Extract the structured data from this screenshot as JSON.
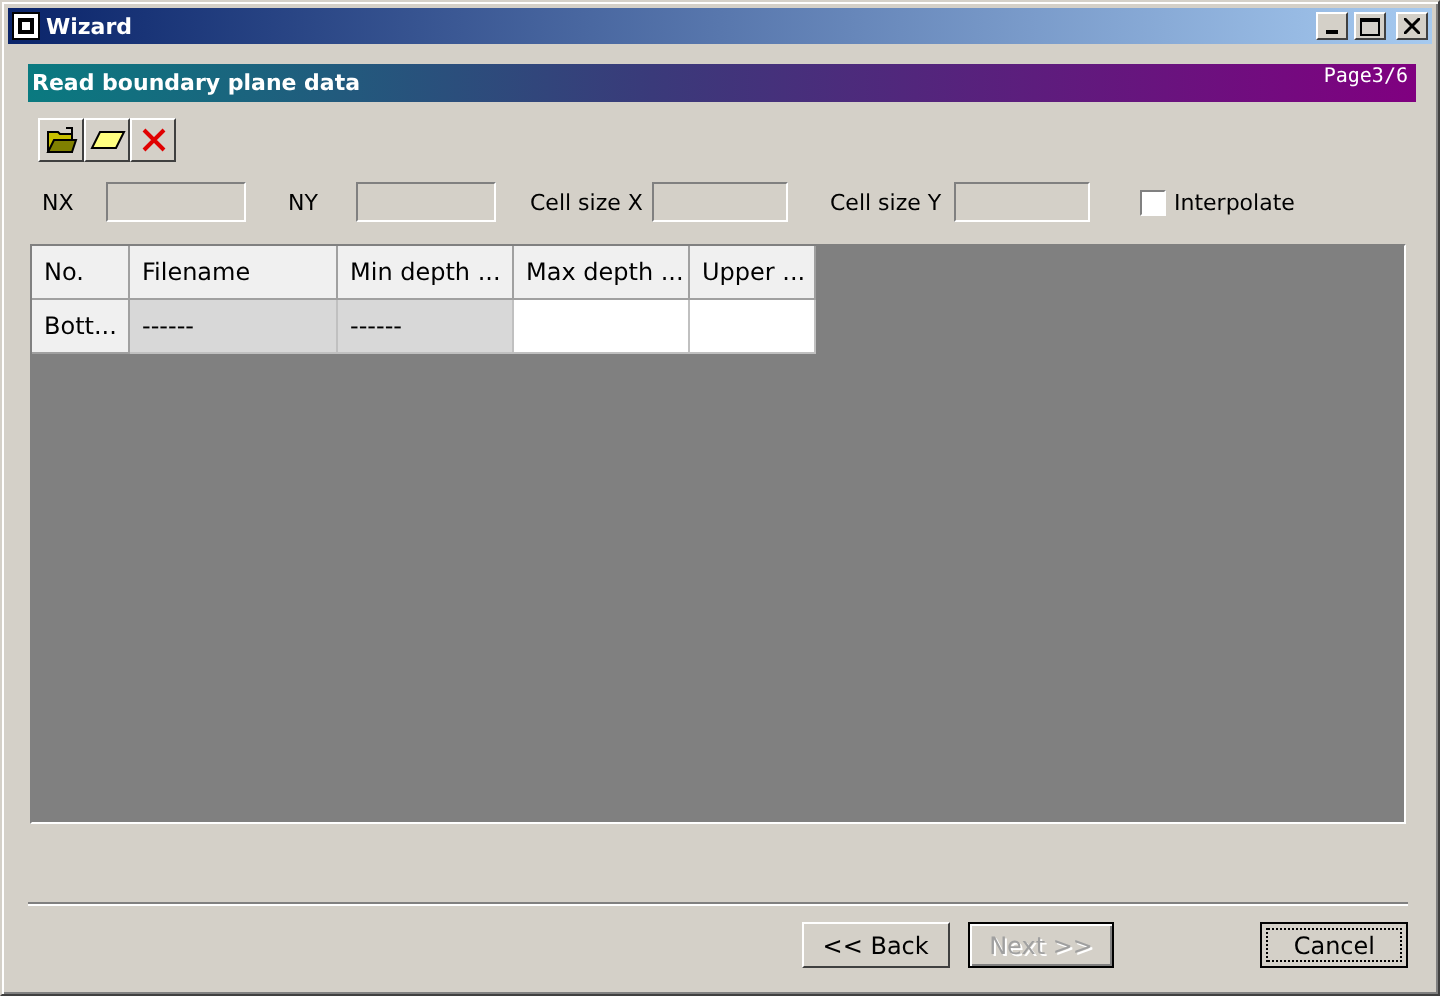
{
  "window": {
    "title": "Wizard"
  },
  "banner": {
    "title": "Read boundary plane data",
    "page": "Page3/6"
  },
  "toolbar": [
    {
      "kind": "open"
    },
    {
      "kind": "plane"
    },
    {
      "kind": "delete"
    }
  ],
  "fields": [
    {
      "label": "NX"
    },
    {
      "label": "NY"
    },
    {
      "label": "Cell size X"
    },
    {
      "label": "Cell size Y"
    }
  ],
  "interpolate": {
    "label": "Interpolate",
    "checked": false
  },
  "table": {
    "columns": [
      "No.",
      "Filename",
      "Min depth ...",
      "Max depth ...",
      "Upper ..."
    ],
    "rows": [
      {
        "cells": [
          {
            "text": "Bott...",
            "kind": "header"
          },
          {
            "text": "------",
            "kind": "readonly"
          },
          {
            "text": "------",
            "kind": "readonly"
          },
          {
            "text": "",
            "kind": "editable"
          },
          {
            "text": "",
            "kind": "editable"
          }
        ]
      }
    ]
  },
  "buttons": [
    {
      "label": "<< Back",
      "disabled": false,
      "focused": false
    },
    {
      "label": "Next >>",
      "disabled": true,
      "focused": false
    },
    {
      "label": "Cancel",
      "disabled": false,
      "focused": true
    }
  ]
}
